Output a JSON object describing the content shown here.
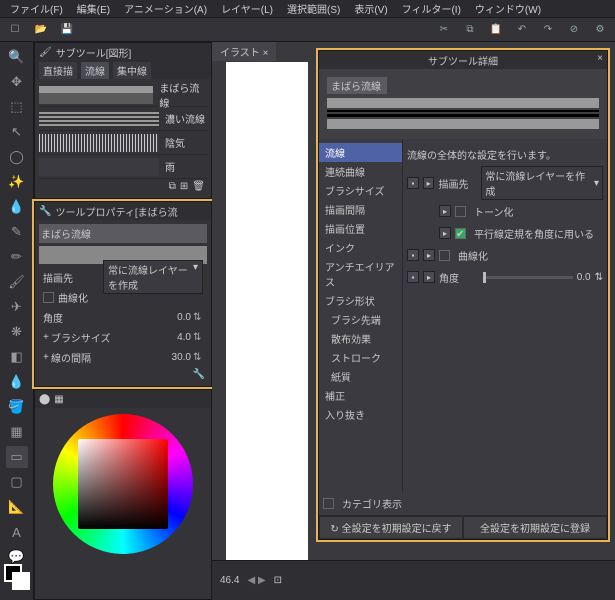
{
  "menu": [
    "ファイル(F)",
    "編集(E)",
    "アニメーション(A)",
    "レイヤー(L)",
    "選択範囲(S)",
    "表示(V)",
    "フィルター(I)",
    "ウィンドウ(W)"
  ],
  "subtool_panel": {
    "title": "サブツール[図形]",
    "tabs": [
      "直接描",
      "流線",
      "集中線"
    ],
    "items": [
      {
        "label": "まばら流線"
      },
      {
        "label": "濃い流線"
      },
      {
        "label": "陰気"
      },
      {
        "label": "雨"
      }
    ]
  },
  "tool_prop": {
    "title": "ツールプロパティ[まばら流",
    "header": "まばら流線",
    "draw_target_label": "描画先",
    "draw_target_value": "常に流線レイヤーを作成",
    "curve_label": "曲線化",
    "angle_label": "角度",
    "angle_value": "0.0",
    "brush_label": "ブラシサイズ",
    "brush_value": "4.0",
    "gap_label": "線の間隔",
    "gap_value": "30.0"
  },
  "detail": {
    "title": "サブツール詳細",
    "header": "まばら流線",
    "categories": [
      "流線",
      "連続曲線",
      "ブラシサイズ",
      "描画間隔",
      "描画位置",
      "インク",
      "アンチエイリアス",
      "ブラシ形状",
      "ブラシ先端",
      "散布効果",
      "ストローク",
      "紙質",
      "補正",
      "入り抜き"
    ],
    "desc": "流線の全体的な設定を行います。",
    "rows": {
      "draw_target_label": "描画先",
      "draw_target_value": "常に流線レイヤーを作成",
      "tone_label": "トーン化",
      "parallel_label": "平行線定規を角度に用いる",
      "curve_label": "曲線化",
      "angle_label": "角度",
      "angle_value": "0.0"
    },
    "cat_show": "カテゴリ表示",
    "reset_btn": "全設定を初期設定に戻す",
    "register_btn": "全設定を初期設定に登録"
  },
  "canvas": {
    "tab": "イラスト",
    "zoom": "46.4"
  }
}
